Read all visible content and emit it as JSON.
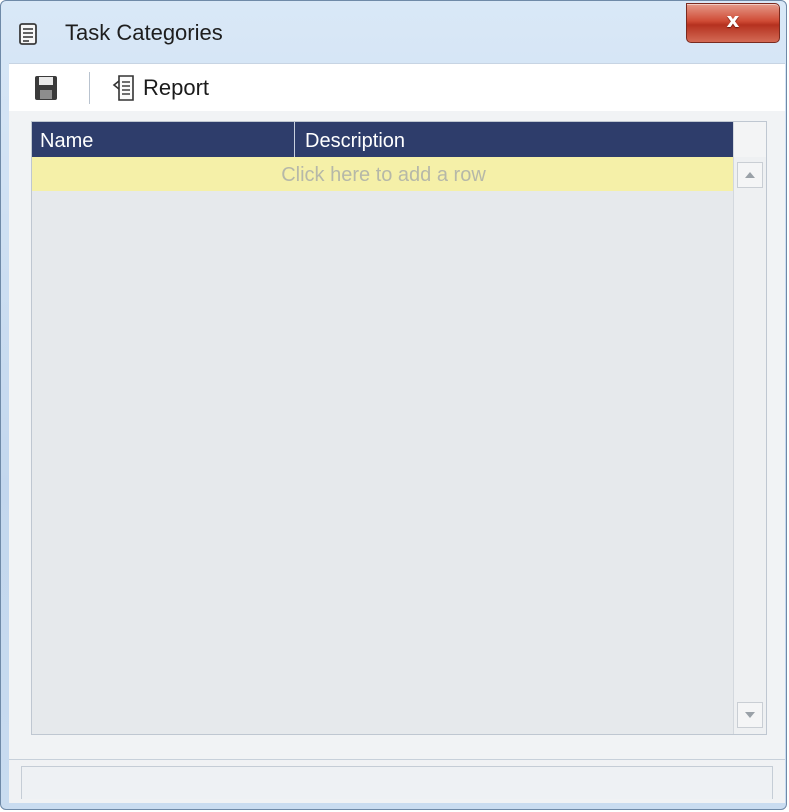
{
  "window": {
    "title": "Task Categories",
    "title_icon": "list-document-icon",
    "close_label": "x"
  },
  "toolbar": {
    "save_icon": "floppy-disk-icon",
    "report_label": "Report",
    "report_icon": "report-document-icon"
  },
  "grid": {
    "columns": [
      "Name",
      "Description"
    ],
    "add_row_text": "Click here to add a row",
    "add_row_color": "#f5f0a8",
    "header_color": "#2e3d6b"
  }
}
